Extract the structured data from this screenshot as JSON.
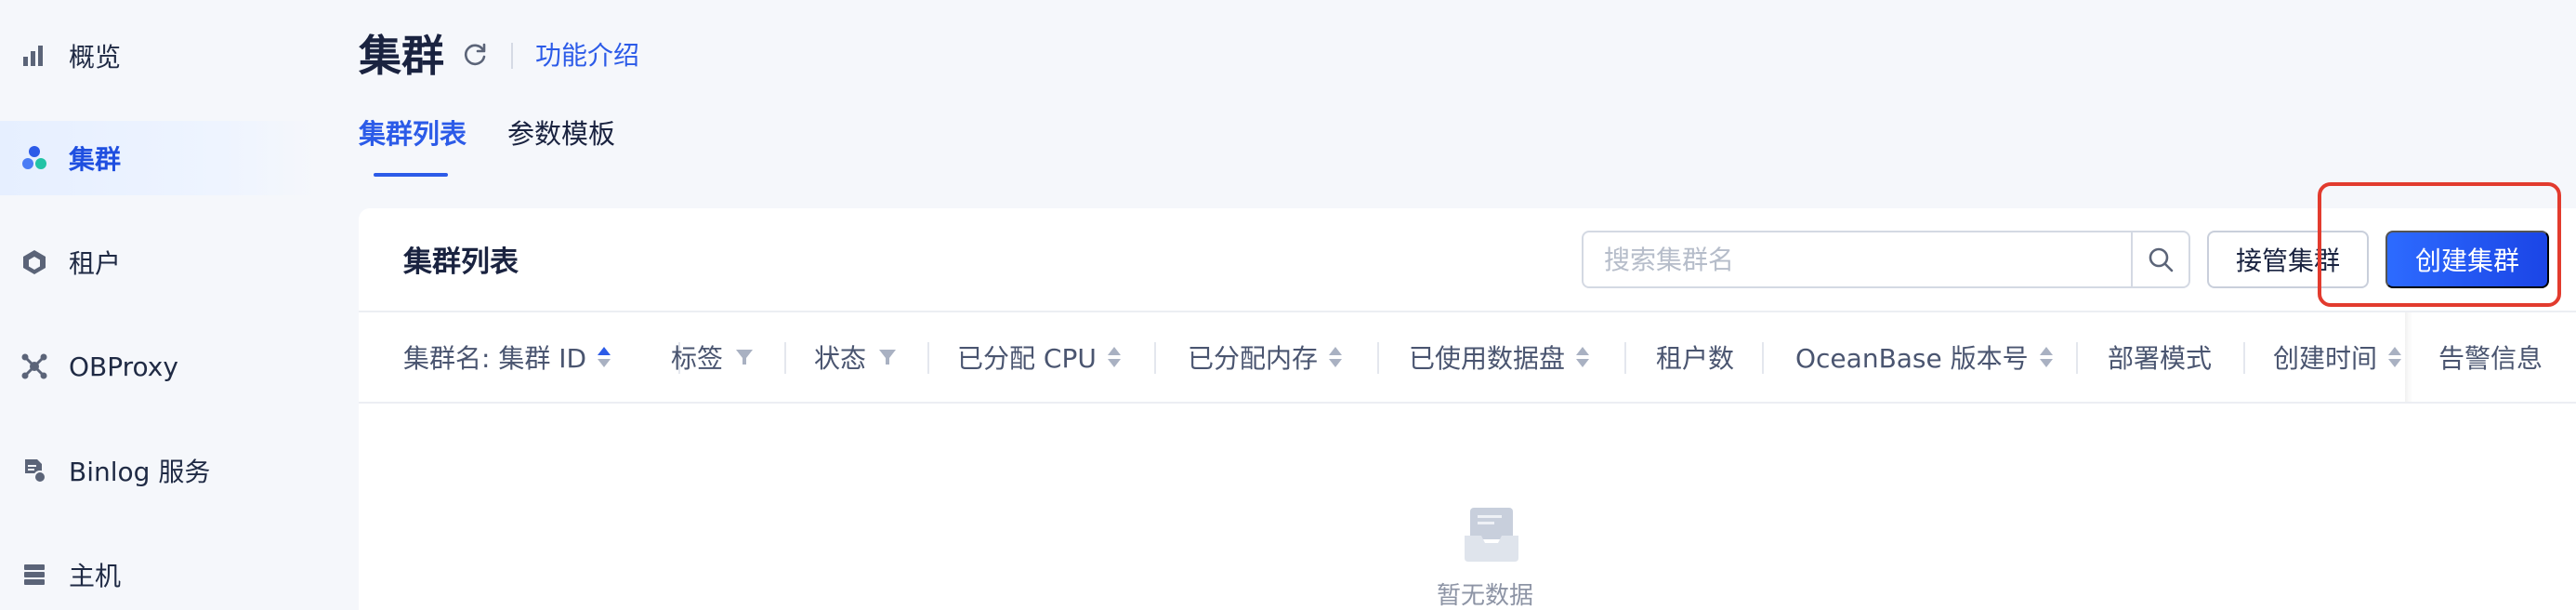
{
  "sidebar": {
    "items": [
      {
        "label": "概览",
        "icon": "bar-chart-icon",
        "active": false
      },
      {
        "label": "集群",
        "icon": "cluster-icon",
        "active": true
      },
      {
        "label": "租户",
        "icon": "tenant-hexagon-icon",
        "active": false
      },
      {
        "label": "OBProxy",
        "icon": "proxy-network-icon",
        "active": false
      },
      {
        "label": "Binlog 服务",
        "icon": "binlog-file-icon",
        "active": false
      },
      {
        "label": "主机",
        "icon": "host-server-icon",
        "active": false
      }
    ]
  },
  "header": {
    "title": "集群",
    "intro_link": "功能介绍"
  },
  "tabs": [
    {
      "label": "集群列表",
      "active": true
    },
    {
      "label": "参数模板",
      "active": false
    }
  ],
  "card": {
    "title": "集群列表",
    "search_placeholder": "搜索集群名",
    "takeover_label": "接管集群",
    "create_label": "创建集群"
  },
  "table": {
    "columns": [
      {
        "label": "集群名: 集群 ID",
        "control": "sort-active-asc"
      },
      {
        "label": "标签",
        "control": "filter"
      },
      {
        "label": "状态",
        "control": "filter"
      },
      {
        "label": "已分配 CPU",
        "control": "sort"
      },
      {
        "label": "已分配内存",
        "control": "sort"
      },
      {
        "label": "已使用数据盘",
        "control": "sort"
      },
      {
        "label": "租户数",
        "control": "none"
      },
      {
        "label": "OceanBase 版本号",
        "control": "sort"
      },
      {
        "label": "部署模式",
        "control": "none"
      },
      {
        "label": "创建时间",
        "control": "sort"
      },
      {
        "label": "告警信息",
        "control": "none"
      }
    ],
    "empty_text": "暂无数据"
  },
  "colors": {
    "accent": "#2c5be8",
    "primary_button": "#1b45e6",
    "highlight": "#e23b2e"
  }
}
